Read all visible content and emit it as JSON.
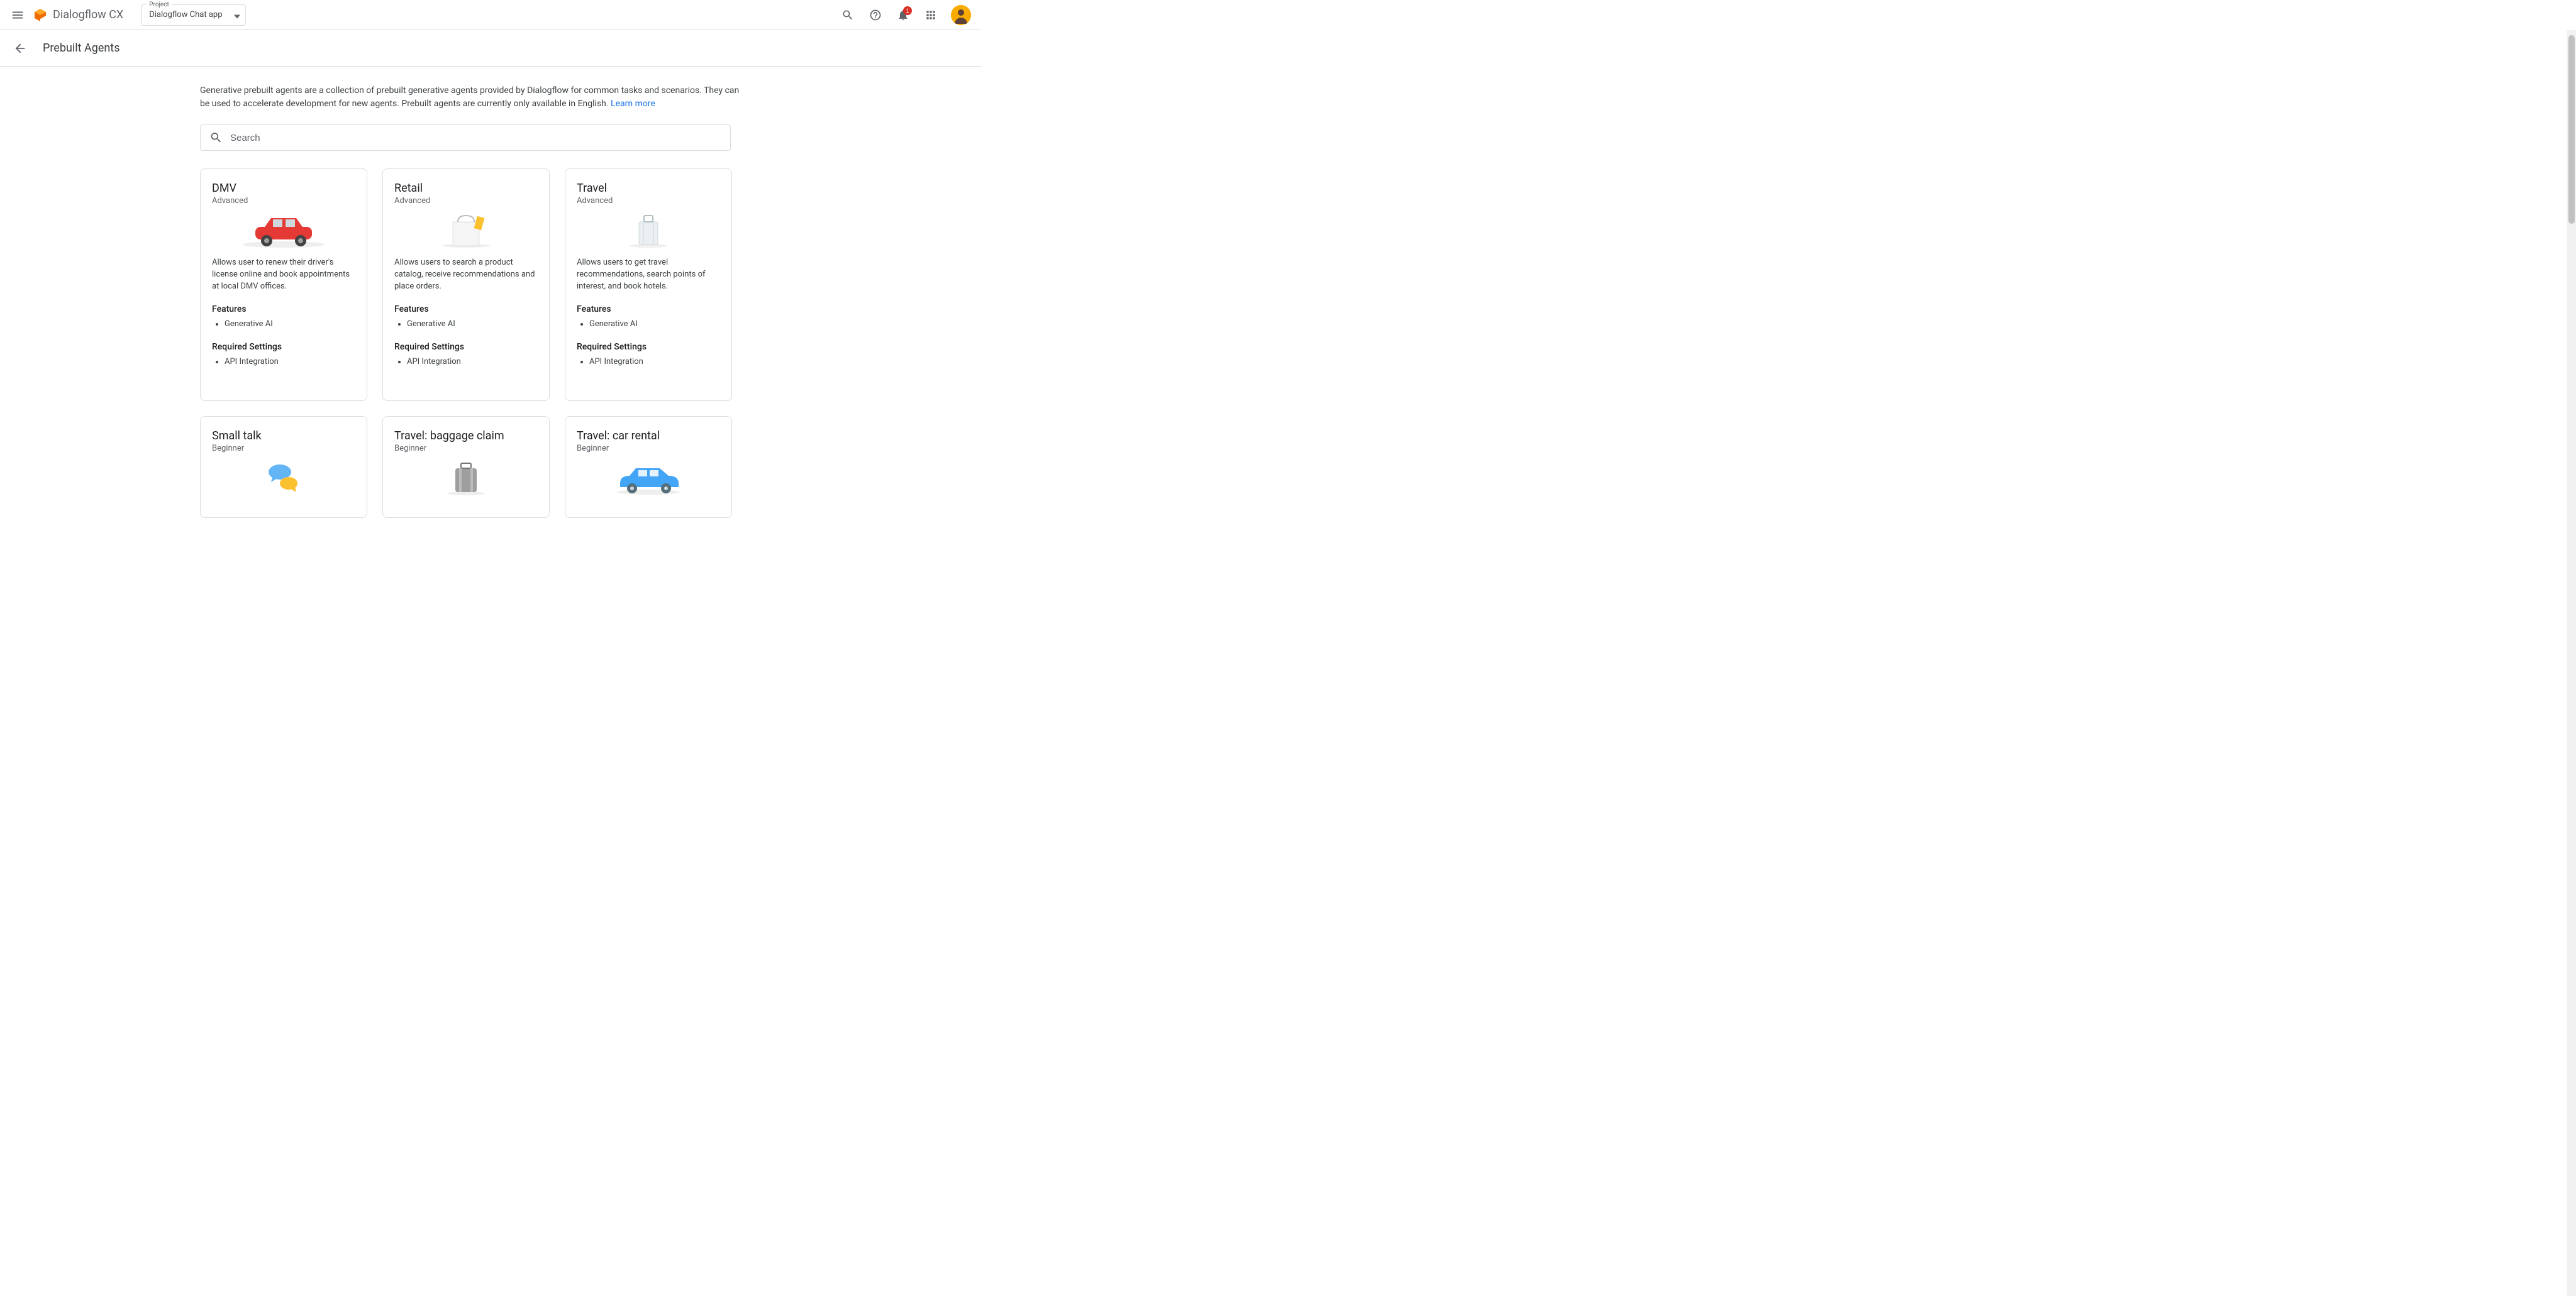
{
  "header": {
    "product_name": "Dialogflow CX",
    "project_label": "Project",
    "project_value": "Dialogflow Chat app",
    "notification_count": "1"
  },
  "page": {
    "title": "Prebuilt Agents",
    "intro_text": "Generative prebuilt agents are a collection of prebuilt generative agents provided by Dialogflow for common tasks and scenarios. They can be used to accelerate development for new agents. Prebuilt agents are currently only available in English. ",
    "learn_more": "Learn more",
    "search_placeholder": "Search"
  },
  "labels": {
    "features": "Features",
    "required_settings": "Required Settings"
  },
  "cards": [
    {
      "title": "DMV",
      "level": "Advanced",
      "desc": "Allows user to renew their driver's license online and book appointments at local DMV offices.",
      "features": [
        "Generative AI"
      ],
      "required": [
        "API Integration"
      ]
    },
    {
      "title": "Retail",
      "level": "Advanced",
      "desc": "Allows users to search a product catalog, receive recommendations and place orders.",
      "features": [
        "Generative AI"
      ],
      "required": [
        "API Integration"
      ]
    },
    {
      "title": "Travel",
      "level": "Advanced",
      "desc": "Allows users to get travel recommendations, search points of interest, and book hotels.",
      "features": [
        "Generative AI"
      ],
      "required": [
        "API Integration"
      ]
    },
    {
      "title": "Small talk",
      "level": "Beginner"
    },
    {
      "title": "Travel: baggage claim",
      "level": "Beginner"
    },
    {
      "title": "Travel: car rental",
      "level": "Beginner"
    }
  ]
}
